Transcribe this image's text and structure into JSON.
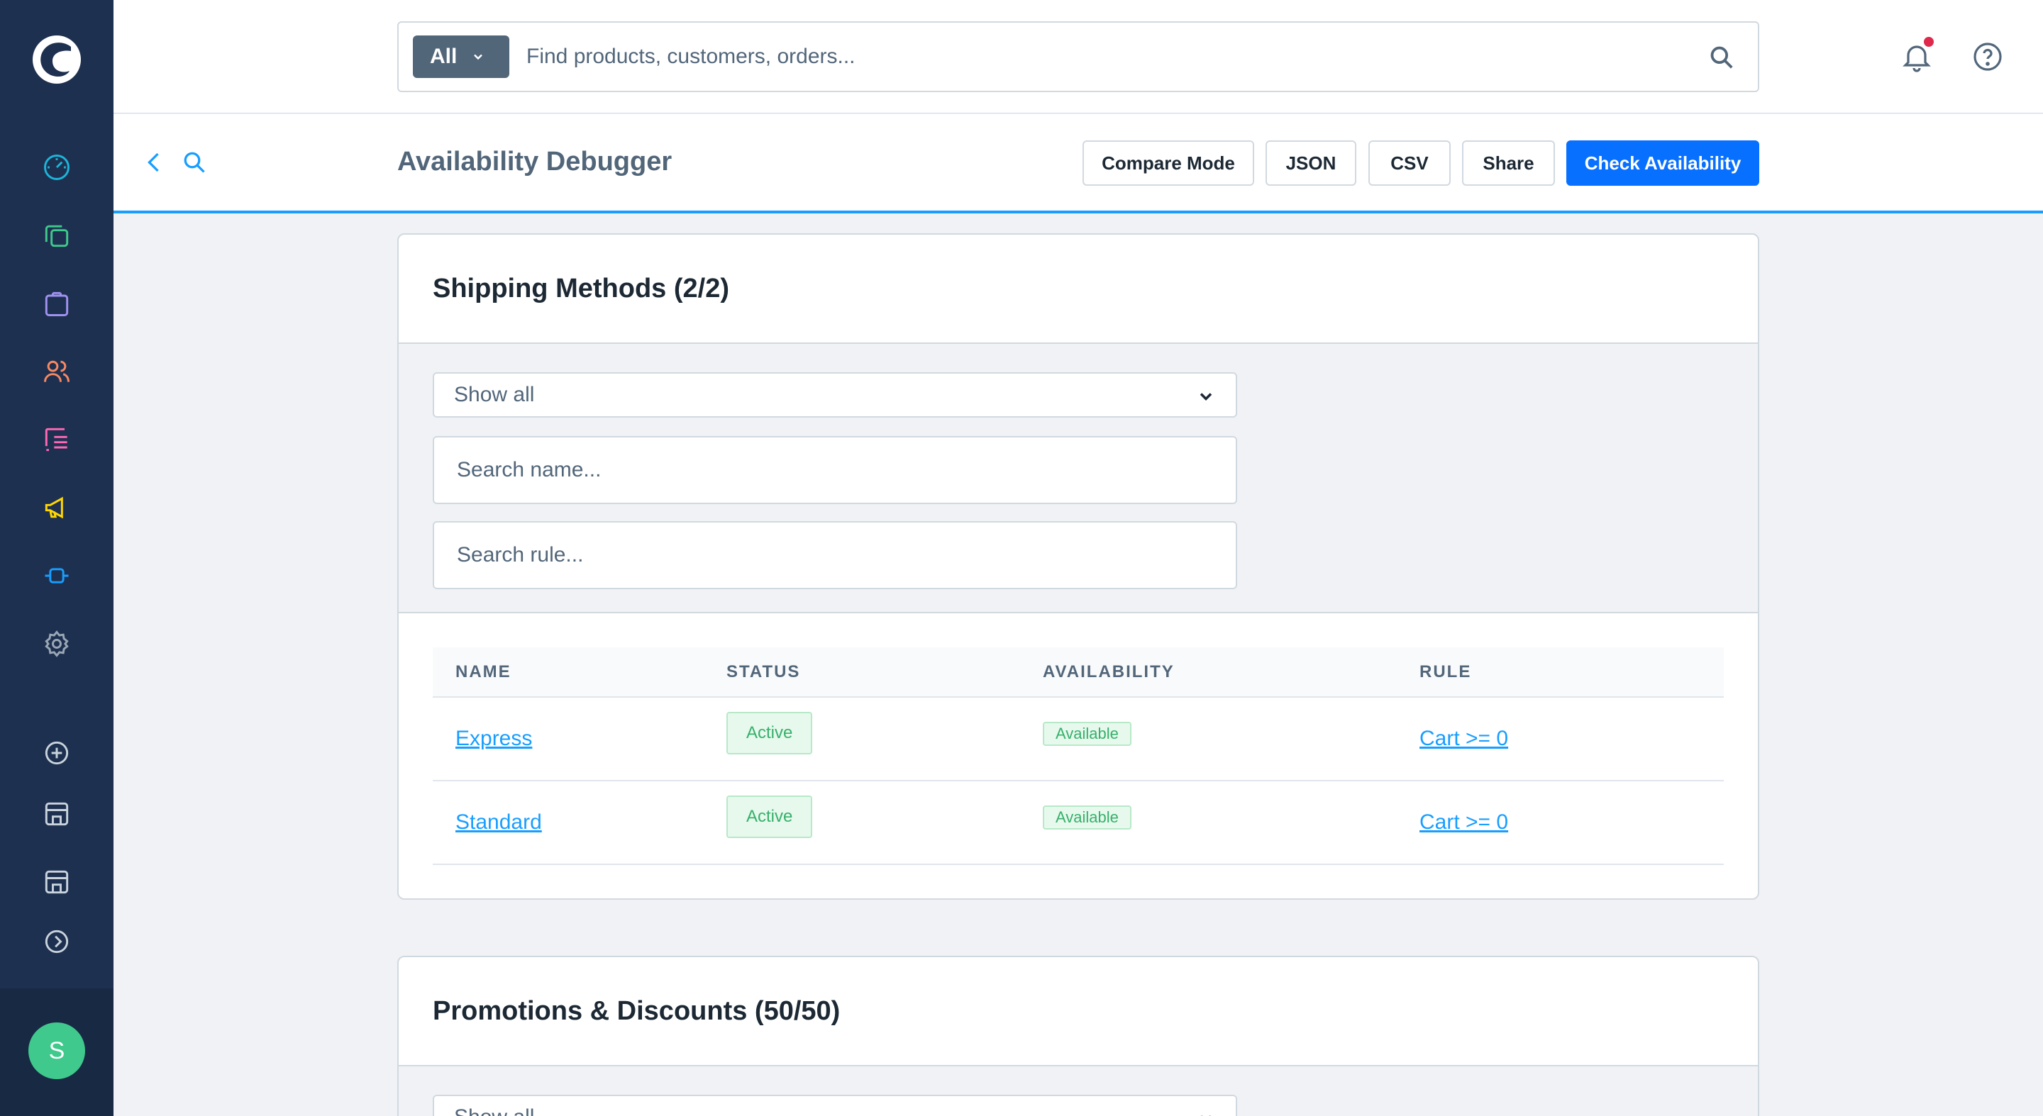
{
  "search": {
    "type_label": "All",
    "placeholder": "Find products, customers, orders..."
  },
  "smartbar": {
    "title": "Availability Debugger",
    "buttons": {
      "compare": "Compare Mode",
      "json": "JSON",
      "csv": "CSV",
      "share": "Share",
      "check": "Check Availability"
    }
  },
  "user": {
    "initial": "S"
  },
  "colors": {
    "sidebar_bg": "#1e3050",
    "primary": "#0870ff",
    "accent": "#189eff",
    "success": "#37b06c",
    "avatar": "#3fc98c"
  },
  "sidebar": {
    "icons": [
      "dashboard-icon",
      "catalog-icon",
      "orders-icon",
      "customers-icon",
      "content-icon",
      "marketing-icon",
      "extensions-icon",
      "settings-icon",
      "add-icon",
      "sales-channel-icon",
      "sales-channel-icon",
      "expand-icon"
    ]
  },
  "shipping": {
    "title": "Shipping Methods (2/2)",
    "filter_select": "Show all",
    "name_placeholder": "Search name...",
    "rule_placeholder": "Search rule...",
    "columns": [
      "NAME",
      "STATUS",
      "AVAILABILITY",
      "RULE"
    ],
    "rows": [
      {
        "name": "Express",
        "status": "Active",
        "availability": "Available",
        "rule": "Cart >= 0"
      },
      {
        "name": "Standard",
        "status": "Active",
        "availability": "Available",
        "rule": "Cart >= 0"
      }
    ]
  },
  "promotions": {
    "title": "Promotions & Discounts (50/50)",
    "filter_select": "Show all"
  }
}
